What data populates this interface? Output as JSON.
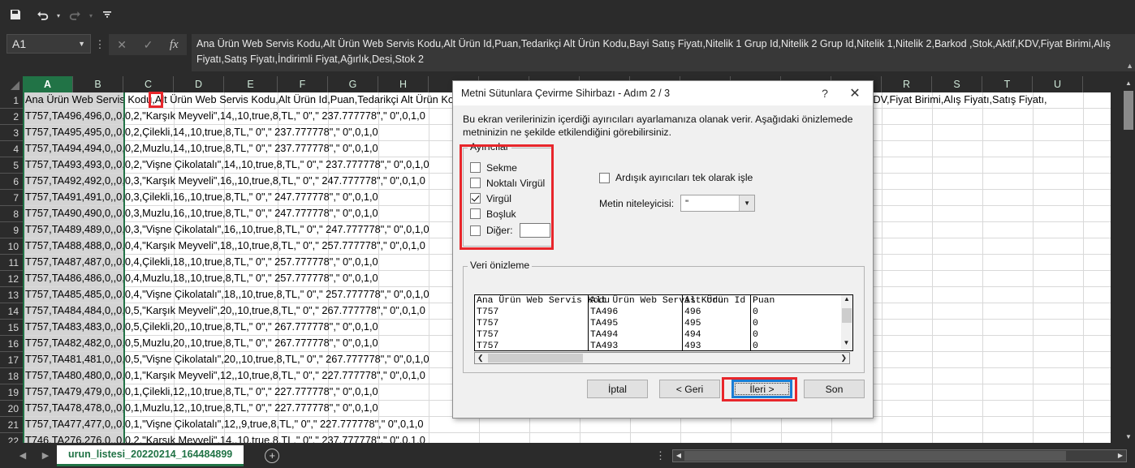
{
  "quick_access": {
    "items": [
      {
        "name": "save-icon",
        "label": "Kaydet"
      },
      {
        "name": "undo-icon",
        "label": "Geri Al"
      },
      {
        "name": "redo-icon",
        "label": "Yinele"
      },
      {
        "name": "customize-toolbar-icon",
        "label": "Araç Çubuğunu Özelleştir"
      }
    ]
  },
  "formula_bar": {
    "name_box_value": "A1",
    "cancel_label": "✕",
    "enter_label": "✓",
    "fx_label": "fx",
    "value": "Ana Ürün Web Servis Kodu,Alt Ürün Web Servis Kodu,Alt Ürün Id,Puan,Tedarikçi Alt Ürün Kodu,Bayi Satış Fiyatı,Nitelik 1 Grup Id,Nitelik 2 Grup Id,Nitelik 1,Nitelik 2,Barkod ,Stok,Aktif,KDV,Fiyat Birimi,Alış Fiyatı,Satış Fiyatı,İndirimli Fiyat,Ağırlık,Desi,Stok 2"
  },
  "sheet": {
    "columns": [
      "A",
      "B",
      "C",
      "D",
      "E",
      "F",
      "G",
      "H",
      "I",
      "J",
      "K",
      "L",
      "M",
      "N",
      "O",
      "P",
      "Q",
      "R",
      "S",
      "T",
      "U"
    ],
    "selected_column": "A",
    "rows": [
      {
        "n": "1",
        "text": "Ana Ürün Web Servis Kodu,Alt Ürün Web Servis Kodu,Alt Ürün Id,Puan,Tedarikçi Alt Ürün Kodu,Bayi Satış Fiyatı,Nitelik 1 Grup Id,Nitelik 2 Grup Id,Nitelik 1,Nitelik 2,Barkod ,Stok,Aktif,KDV,Fiyat Birimi,Alış Fiyatı,Satış Fiyatı,"
      },
      {
        "n": "2",
        "text": "T757,TA496,496,0,,0,0,2,\"Karşık Meyveli\",14,,10,true,8,TL,\" 0\",\" 237.777778\",\" 0\",0,1,0"
      },
      {
        "n": "3",
        "text": "T757,TA495,495,0,,0,0,2,Çilekli,14,,10,true,8,TL,\" 0\",\" 237.777778\",\" 0\",0,1,0"
      },
      {
        "n": "4",
        "text": "T757,TA494,494,0,,0,0,2,Muzlu,14,,10,true,8,TL,\" 0\",\" 237.777778\",\" 0\",0,1,0"
      },
      {
        "n": "5",
        "text": "T757,TA493,493,0,,0,0,2,\"Vişne Çikolatalı\",14,,10,true,8,TL,\" 0\",\" 237.777778\",\" 0\",0,1,0"
      },
      {
        "n": "6",
        "text": "T757,TA492,492,0,,0,0,3,\"Karşık Meyveli\",16,,10,true,8,TL,\" 0\",\" 247.777778\",\" 0\",0,1,0"
      },
      {
        "n": "7",
        "text": "T757,TA491,491,0,,0,0,3,Çilekli,16,,10,true,8,TL,\" 0\",\" 247.777778\",\" 0\",0,1,0"
      },
      {
        "n": "8",
        "text": "T757,TA490,490,0,,0,0,3,Muzlu,16,,10,true,8,TL,\" 0\",\" 247.777778\",\" 0\",0,1,0"
      },
      {
        "n": "9",
        "text": "T757,TA489,489,0,,0,0,3,\"Vişne Çikolatalı\",16,,10,true,8,TL,\" 0\",\" 247.777778\",\" 0\",0,1,0"
      },
      {
        "n": "10",
        "text": "T757,TA488,488,0,,0,0,4,\"Karşık Meyveli\",18,,10,true,8,TL,\" 0\",\" 257.777778\",\" 0\",0,1,0"
      },
      {
        "n": "11",
        "text": "T757,TA487,487,0,,0,0,4,Çilekli,18,,10,true,8,TL,\" 0\",\" 257.777778\",\" 0\",0,1,0"
      },
      {
        "n": "12",
        "text": "T757,TA486,486,0,,0,0,4,Muzlu,18,,10,true,8,TL,\" 0\",\" 257.777778\",\" 0\",0,1,0"
      },
      {
        "n": "13",
        "text": "T757,TA485,485,0,,0,0,4,\"Vişne Çikolatalı\",18,,10,true,8,TL,\" 0\",\" 257.777778\",\" 0\",0,1,0"
      },
      {
        "n": "14",
        "text": "T757,TA484,484,0,,0,0,5,\"Karşık Meyveli\",20,,10,true,8,TL,\" 0\",\" 267.777778\",\" 0\",0,1,0"
      },
      {
        "n": "15",
        "text": "T757,TA483,483,0,,0,0,5,Çilekli,20,,10,true,8,TL,\" 0\",\" 267.777778\",\" 0\",0,1,0"
      },
      {
        "n": "16",
        "text": "T757,TA482,482,0,,0,0,5,Muzlu,20,,10,true,8,TL,\" 0\",\" 267.777778\",\" 0\",0,1,0"
      },
      {
        "n": "17",
        "text": "T757,TA481,481,0,,0,0,5,\"Vişne Çikolatalı\",20,,10,true,8,TL,\" 0\",\" 267.777778\",\" 0\",0,1,0"
      },
      {
        "n": "18",
        "text": "T757,TA480,480,0,,0,0,1,\"Karşık Meyveli\",12,,10,true,8,TL,\" 0\",\" 227.777778\",\" 0\",0,1,0"
      },
      {
        "n": "19",
        "text": "T757,TA479,479,0,,0,0,1,Çilekli,12,,10,true,8,TL,\" 0\",\" 227.777778\",\" 0\",0,1,0"
      },
      {
        "n": "20",
        "text": "T757,TA478,478,0,,0,0,1,Muzlu,12,,10,true,8,TL,\" 0\",\" 227.777778\",\" 0\",0,1,0"
      },
      {
        "n": "21",
        "text": "T757,TA477,477,0,,0,0,1,\"Vişne Çikolatalı\",12,,9,true,8,TL,\" 0\",\" 227.777778\",\" 0\",0,1,0"
      },
      {
        "n": "22",
        "text": "T746,TA276,276,0,,0,0,2,\"Karşık Meyveli\",14,,10,true,8,TL,\" 0\",\" 237.777778\",\" 0\",0,1,0"
      }
    ],
    "overflow_right_text": "d ,Stok,Aktif,KDV,Fiyat Birimi,Alış Fiyatı,Satış Fiyatı,"
  },
  "tab_bar": {
    "prev_label": "◀",
    "next_label": "▶",
    "sheet_name": "urun_listesi_20220214_164484899",
    "add_sheet_label": "+"
  },
  "dialog": {
    "title": "Metni Sütunlara Çevirme Sihirbazı - Adım 2 / 3",
    "help_label": "?",
    "close_label": "✕",
    "description": "Bu ekran verilerinizin içerdiği ayırıcıları ayarlamanıza olanak verir. Aşağıdaki önizlemede metninizin ne şekilde etkilendiğini görebilirsiniz.",
    "delimiters": {
      "group_label": "Ayırıcılar",
      "items": [
        {
          "label": "Sekme",
          "checked": false
        },
        {
          "label": "Noktalı Virgül",
          "checked": false
        },
        {
          "label": "Virgül",
          "checked": true
        },
        {
          "label": "Boşluk",
          "checked": false
        },
        {
          "label": "Diğer:",
          "checked": false,
          "other_value": ""
        }
      ]
    },
    "consecutive": {
      "label": "Ardışık ayırıcıları tek olarak işle",
      "checked": false
    },
    "text_qualifier": {
      "label": "Metin niteleyicisi:",
      "value": "\""
    },
    "preview": {
      "group_label": "Veri önizleme",
      "headers": [
        "Ana Ürün Web Servis Kodu",
        "Alt Ürün Web Servis Kodu",
        "Alt Ürün Id",
        "Puan"
      ],
      "rows": [
        [
          "T757",
          "TA496",
          "496",
          "0"
        ],
        [
          "T757",
          "TA495",
          "495",
          "0"
        ],
        [
          "T757",
          "TA494",
          "494",
          "0"
        ],
        [
          "T757",
          "TA493",
          "493",
          "0"
        ]
      ]
    },
    "buttons": [
      {
        "label": "İptal",
        "focused": false
      },
      {
        "label": "< Geri",
        "focused": false
      },
      {
        "label": "İleri >",
        "focused": true
      },
      {
        "label": "Son",
        "focused": false
      }
    ]
  },
  "annotations": {
    "accent_red": "#e8262b",
    "accent_blue": "#1a7dd4",
    "excel_green": "#217346"
  }
}
